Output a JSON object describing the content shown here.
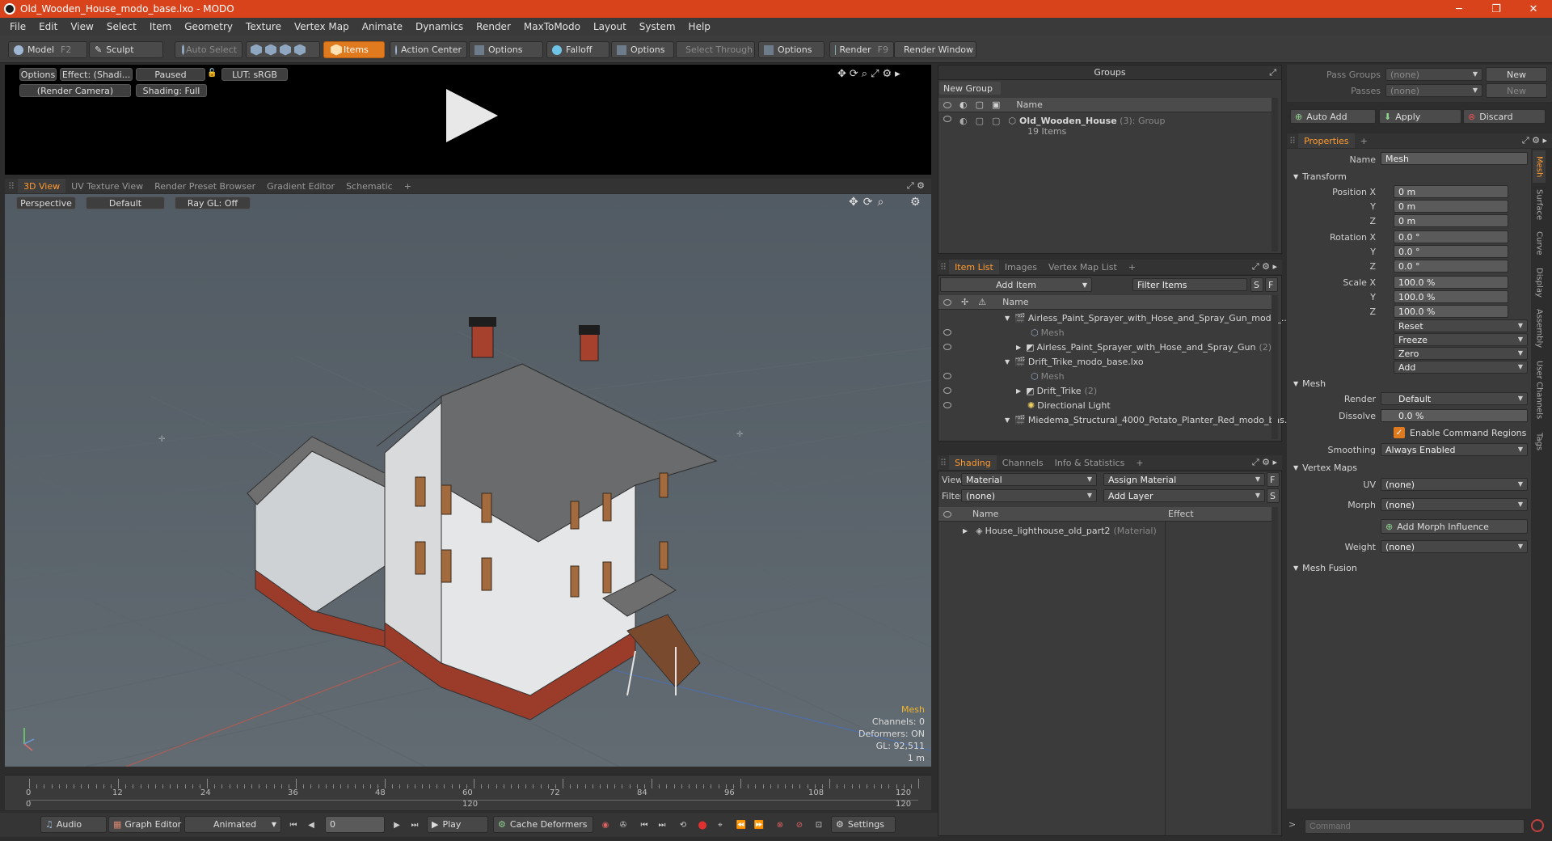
{
  "window": {
    "title": "Old_Wooden_House_modo_base.lxo - MODO",
    "minimize": "─",
    "maximize": "❐",
    "close": "✕"
  },
  "menu": [
    "File",
    "Edit",
    "View",
    "Select",
    "Item",
    "Geometry",
    "Texture",
    "Vertex Map",
    "Animate",
    "Dynamics",
    "Render",
    "MaxToModo",
    "Layout",
    "System",
    "Help"
  ],
  "toolbar": {
    "model": "Model",
    "model_key": "F2",
    "sculpt": "Sculpt",
    "auto_select": "Auto Select",
    "items": "Items",
    "action_center": "Action Center",
    "options1": "Options",
    "falloff": "Falloff",
    "options2": "Options",
    "select_through": "Select Through",
    "options3": "Options",
    "render": "Render",
    "render_key": "F9",
    "render_window": "Render Window"
  },
  "preview": {
    "options": "Options",
    "effect": "Effect: (Shadi...",
    "paused": "Paused",
    "lut": "LUT: sRGB",
    "camera": "(Render Camera)",
    "shading": "Shading: Full"
  },
  "viewport_tabs": [
    "3D View",
    "UV Texture View",
    "Render Preset Browser",
    "Gradient Editor",
    "Schematic",
    "+"
  ],
  "viewport": {
    "perspective": "Perspective",
    "default": "Default",
    "raygl": "Ray GL: Off",
    "info": {
      "title": "Mesh",
      "channels": "Channels: 0",
      "deformers": "Deformers: ON",
      "gl": "GL: 92,511",
      "scale": "1 m"
    }
  },
  "timeline": {
    "labels": [
      "0",
      "12",
      "24",
      "36",
      "48",
      "60",
      "72",
      "84",
      "96",
      "108",
      "120"
    ],
    "bottom_labels": [
      "0",
      "120",
      "120"
    ]
  },
  "bottom": {
    "audio": "Audio",
    "graph_editor": "Graph Editor",
    "animated": "Animated",
    "frame": "0",
    "play": "Play",
    "cache": "Cache Deformers",
    "settings": "Settings"
  },
  "groups": {
    "header": "Groups",
    "new_group": "New Group",
    "col_name": "Name",
    "item_name": "Old_Wooden_House",
    "item_count": "(3)",
    "item_type": ": Group",
    "item_sub": "19 Items"
  },
  "item_list": {
    "tabs": [
      "Item List",
      "Images",
      "Vertex Map List",
      "+"
    ],
    "add_item": "Add Item",
    "filter": "Filter Items",
    "s": "S",
    "f": "F",
    "col_name": "Name",
    "rows": [
      {
        "label": "Airless_Paint_Sprayer_with_Hose_and_Spray_Gun_modo_...",
        "style": "normal"
      },
      {
        "label": "Mesh",
        "style": "dim"
      },
      {
        "label": "Airless_Paint_Sprayer_with_Hose_and_Spray_Gun",
        "extra": "(2)",
        "style": "normal"
      },
      {
        "label": "Drift_Trike_modo_base.lxo",
        "style": "normal"
      },
      {
        "label": "Mesh",
        "style": "dim"
      },
      {
        "label": "Drift_Trike",
        "extra": "(2)",
        "style": "normal"
      },
      {
        "label": "Directional Light",
        "style": "normal"
      },
      {
        "label": "Miedema_Structural_4000_Potato_Planter_Red_modo_bas...",
        "style": "normal"
      }
    ]
  },
  "shading": {
    "tabs": [
      "Shading",
      "Channels",
      "Info & Statistics",
      "+"
    ],
    "view_label": "View",
    "view_value": "Material",
    "assign": "Assign Material",
    "f": "F",
    "filter_label": "Filter",
    "filter_value": "(none)",
    "add_layer": "Add Layer",
    "s": "S",
    "col_name": "Name",
    "col_effect": "Effect",
    "row": "House_lighthouse_old_part2",
    "row_type": "(Material)"
  },
  "right": {
    "pass_groups_label": "Pass Groups",
    "pass_groups_value": "(none)",
    "new": "New",
    "passes_label": "Passes",
    "passes_value": "(none)",
    "new2": "New",
    "auto_add": "Auto Add",
    "apply": "Apply",
    "discard": "Discard",
    "properties_tab": "Properties",
    "plus": "+",
    "name_label": "Name",
    "name_value": "Mesh",
    "transform": "Transform",
    "position_x_label": "Position X",
    "y": "Y",
    "z": "Z",
    "position": [
      "0 m",
      "0 m",
      "0 m"
    ],
    "rotation_x_label": "Rotation X",
    "rotation": [
      "0.0 °",
      "0.0 °",
      "0.0 °"
    ],
    "scale_x_label": "Scale X",
    "scale": [
      "100.0 %",
      "100.0 %",
      "100.0 %"
    ],
    "actions": [
      "Reset",
      "Freeze",
      "Zero",
      "Add"
    ],
    "mesh": "Mesh",
    "render_label": "Render",
    "render_value": "Default",
    "dissolve_label": "Dissolve",
    "dissolve_value": "0.0 %",
    "enable_regions": "Enable Command Regions",
    "smoothing_label": "Smoothing",
    "smoothing_value": "Always Enabled",
    "vertex_maps": "Vertex Maps",
    "uv_label": "UV",
    "uv_value": "(none)",
    "morph_label": "Morph",
    "morph_value": "(none)",
    "add_morph": "Add Morph Influence",
    "weight_label": "Weight",
    "weight_value": "(none)",
    "mesh_fusion": "Mesh Fusion",
    "command_placeholder": "Command",
    "side_tabs": [
      "Mesh",
      "Surface",
      "Curve",
      "Display",
      "Assembly",
      "User Channels",
      "Tags"
    ]
  }
}
